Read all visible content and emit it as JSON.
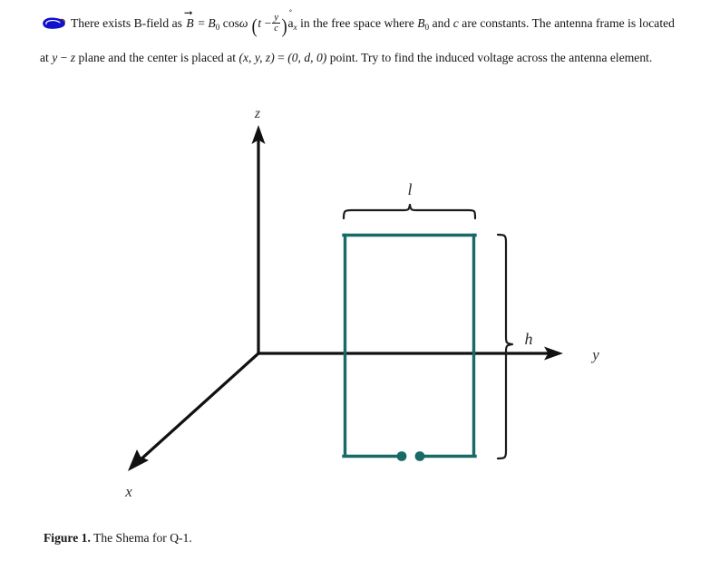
{
  "document": {
    "problem": {
      "marker_icon": "blue-blob-annotation",
      "marker_color": "#1111cc",
      "text_lead": "There exists B-field as",
      "formula": {
        "lhs": "B",
        "equals": "=",
        "amplitude": "B",
        "amplitude_sub": "0",
        "cos": "cos",
        "omega": "ω",
        "paren_open": "(",
        "t": "t",
        "minus": "−",
        "frac_num": "y",
        "frac_den": "c",
        "paren_close": ")",
        "unit_vector_hat": "˚",
        "unit_vector_base": "a",
        "unit_vector_sub": "x"
      },
      "text_after_formula": "in the free space where",
      "const_b0": "B",
      "const_b0_sub": "0",
      "and": "and",
      "const_c": "c",
      "text_are": "are",
      "line2_a": "constants. The antenna frame is located at",
      "line2_y": "y",
      "line2_dash": "−",
      "line2_z": "z",
      "line2_b": "plane and the center is placed at",
      "line2_coord": "(x, y, z)",
      "line2_eq": "=",
      "line3_coord": "(0, d, 0)",
      "line3_text": "point. Try to find the induced voltage across the antenna element."
    },
    "caption": {
      "lead": "Figure 1.",
      "rest": "The Shema for Q-1."
    }
  },
  "figure": {
    "axes": {
      "z_label": "z",
      "y_label": "y",
      "x_label": "x",
      "axis_color": "#111111"
    },
    "antenna": {
      "color": "#176a66",
      "terminal_dot_color": "#176a66"
    },
    "dimensions": {
      "width_label": "l",
      "height_label": "h"
    }
  }
}
